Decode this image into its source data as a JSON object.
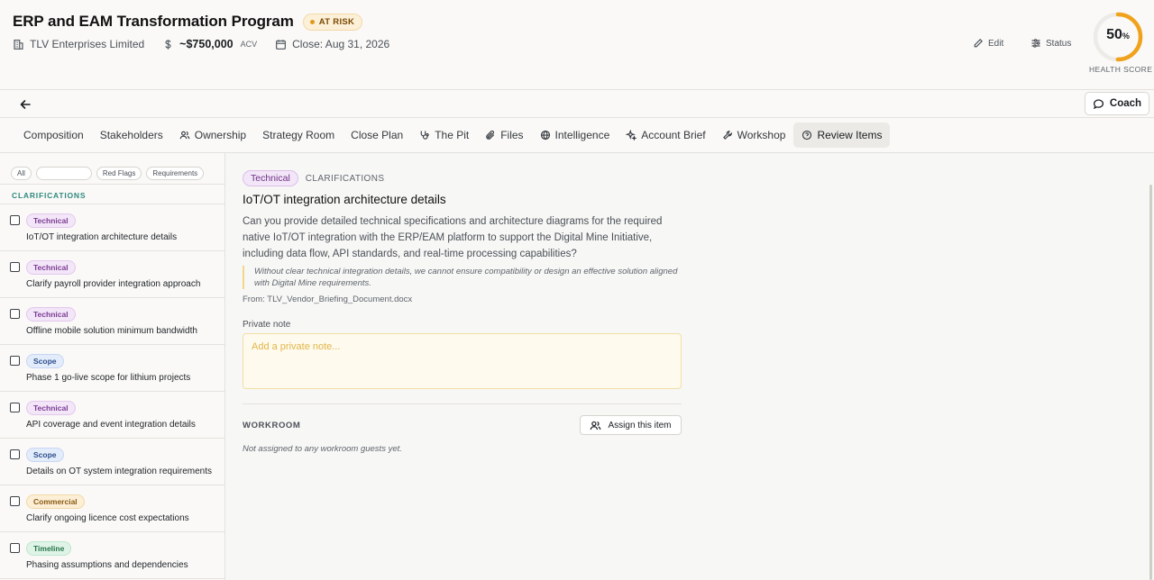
{
  "header": {
    "title": "ERP and EAM Transformation Program",
    "status_badge": "AT RISK",
    "company": "TLV Enterprises Limited",
    "acv_value": "~$750,000",
    "acv_unit": "ACV",
    "close_date": "Close: Aug 31, 2026",
    "edit_label": "Edit",
    "status_label": "Status",
    "health_score": 50,
    "health_percent_sign": "%",
    "health_label": "HEALTH SCORE"
  },
  "toolbar": {
    "coach_label": "Coach"
  },
  "tabs": [
    {
      "label": "Composition",
      "icon": ""
    },
    {
      "label": "Stakeholders",
      "icon": ""
    },
    {
      "label": "Ownership",
      "icon": "users-icon"
    },
    {
      "label": "Strategy Room",
      "icon": ""
    },
    {
      "label": "Close Plan",
      "icon": ""
    },
    {
      "label": "The Pit",
      "icon": "stethoscope-icon"
    },
    {
      "label": "Files",
      "icon": "paperclip-icon"
    },
    {
      "label": "Intelligence",
      "icon": "globe-icon"
    },
    {
      "label": "Account Brief",
      "icon": "sparkles-icon"
    },
    {
      "label": "Workshop",
      "icon": "wrench-icon"
    },
    {
      "label": "Review Items",
      "icon": "help-circle-icon",
      "active": true
    }
  ],
  "filters": {
    "all": "All",
    "search_value": "",
    "red_flags": "Red Flags",
    "requirements": "Requirements"
  },
  "list": {
    "section_title": "CLARIFICATIONS",
    "items": [
      {
        "tag": "Technical",
        "label": "IoT/OT integration architecture details"
      },
      {
        "tag": "Technical",
        "label": "Clarify payroll provider integration approach"
      },
      {
        "tag": "Technical",
        "label": "Offline mobile solution minimum bandwidth"
      },
      {
        "tag": "Scope",
        "label": "Phase 1 go-live scope for lithium projects"
      },
      {
        "tag": "Technical",
        "label": "API coverage and event integration details"
      },
      {
        "tag": "Scope",
        "label": "Details on OT system integration requirements"
      },
      {
        "tag": "Commercial",
        "label": "Clarify ongoing licence cost expectations"
      },
      {
        "tag": "Timeline",
        "label": "Phasing assumptions and dependencies"
      }
    ]
  },
  "detail": {
    "tag": "Technical",
    "category": "CLARIFICATIONS",
    "title": "IoT/OT integration architecture details",
    "description": "Can you provide detailed technical specifications and architecture diagrams for the required native IoT/OT integration with the ERP/EAM platform to support the Digital Mine Initiative, including data flow, API standards, and real-time processing capabilities?",
    "quote": "Without clear technical integration details, we cannot ensure compatibility or design an effective solution aligned with Digital Mine requirements.",
    "source": "From: TLV_Vendor_Briefing_Document.docx",
    "note_label": "Private note",
    "note_placeholder": "Add a private note...",
    "note_value": "",
    "workroom_label": "WORKROOM",
    "assign_label": "Assign this item",
    "workroom_empty": "Not assigned to any workroom guests yet."
  },
  "colors": {
    "health_ring": "#f0a21c",
    "section_accent": "#2f8a7e",
    "note_background": "#fefaee"
  }
}
